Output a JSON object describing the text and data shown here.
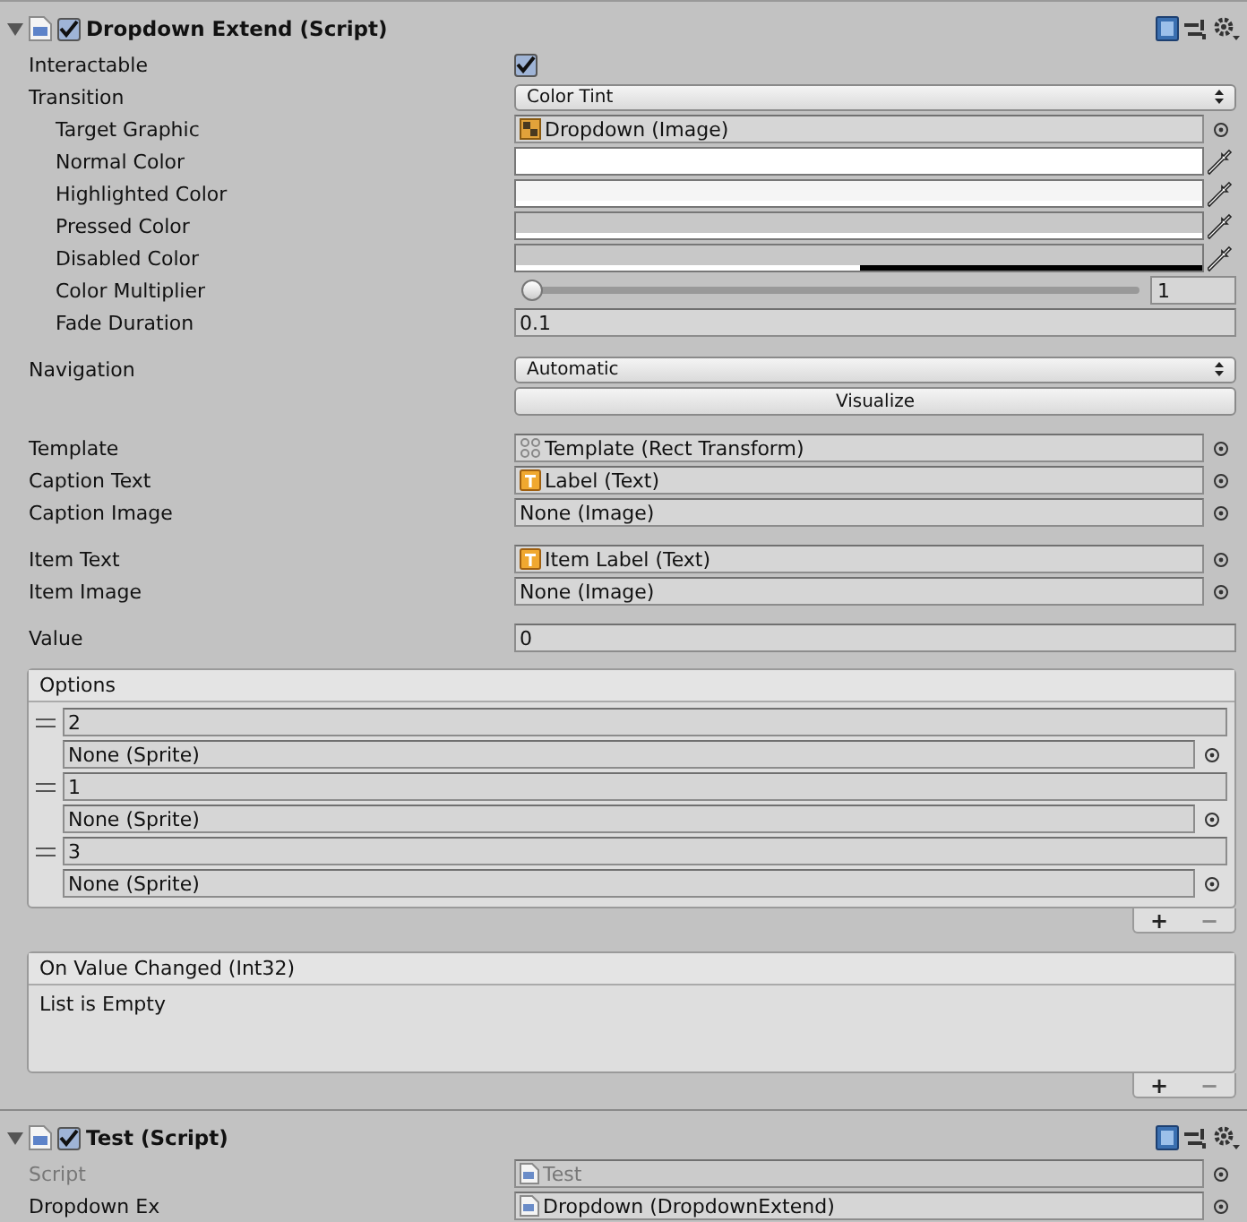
{
  "components": [
    {
      "title": "Dropdown Extend (Script)",
      "expanded": true,
      "enabled": true,
      "sections": [
        [
          {
            "kind": "checkbox",
            "label": "Interactable",
            "checked": true,
            "indented": false
          },
          {
            "kind": "popup",
            "label": "Transition",
            "value": "Color Tint",
            "indented": false
          },
          {
            "kind": "image-ref",
            "label": "Target Graphic",
            "value": "Dropdown (Image)",
            "indented": true,
            "disabled": false
          },
          {
            "kind": "color",
            "label": "Normal Color",
            "color": "#ffffff",
            "level": 1,
            "indented": true
          },
          {
            "kind": "color",
            "label": "Highlighted Color",
            "color": "#f5f5f5",
            "level": 1,
            "indented": true
          },
          {
            "kind": "color",
            "label": "Pressed Color",
            "color": "#c8c8c8",
            "level": 1,
            "indented": true
          },
          {
            "kind": "color",
            "label": "Disabled Color",
            "color": "#c8c8c8",
            "level": 0.5,
            "indented": true
          },
          {
            "kind": "slider",
            "label": "Color Multiplier",
            "level": 0,
            "reading": "1",
            "indented": true
          },
          {
            "kind": "number",
            "label": "Fade Duration",
            "value": "0.1",
            "indented": true
          }
        ],
        [
          {
            "kind": "popup",
            "label": "Navigation",
            "value": "Automatic",
            "indented": false
          },
          {
            "kind": "button",
            "value": "Visualize"
          }
        ],
        [
          {
            "kind": "rect-ref",
            "label": "Template",
            "value": "Template (Rect Transform)",
            "indented": false,
            "disabled": false
          },
          {
            "kind": "text-ref",
            "label": "Caption Text",
            "value": "Label (Text)",
            "indented": false,
            "disabled": false
          },
          {
            "kind": "object",
            "label": "Caption Image",
            "value": "None (Image)",
            "indented": false,
            "disabled": false
          }
        ],
        [
          {
            "kind": "text-ref",
            "label": "Item Text",
            "value": "Item Label (Text)",
            "indented": false,
            "disabled": false
          },
          {
            "kind": "object",
            "label": "Item Image",
            "value": "None (Image)",
            "indented": false,
            "disabled": false
          }
        ],
        [
          {
            "kind": "number",
            "label": "Value",
            "value": "0",
            "indented": false
          }
        ]
      ],
      "options": {
        "title": "Options",
        "items": [
          {
            "text": "2",
            "image": "None (Sprite)"
          },
          {
            "text": "1",
            "image": "None (Sprite)"
          },
          {
            "text": "3",
            "image": "None (Sprite)"
          }
        ],
        "add": "+",
        "remove": "−"
      },
      "event": {
        "title": "On Value Changed (Int32)",
        "empty": "List is Empty",
        "add": "+",
        "remove": "−"
      }
    },
    {
      "title": "Test (Script)",
      "expanded": true,
      "enabled": true,
      "sections": [
        [
          {
            "kind": "script-ref",
            "label": "Script",
            "value": "Test",
            "indented": false,
            "disabled": true
          },
          {
            "kind": "script-ref",
            "label": "Dropdown Ex",
            "value": "Dropdown (DropdownExtend)",
            "indented": false,
            "disabled": false
          }
        ]
      ]
    }
  ]
}
